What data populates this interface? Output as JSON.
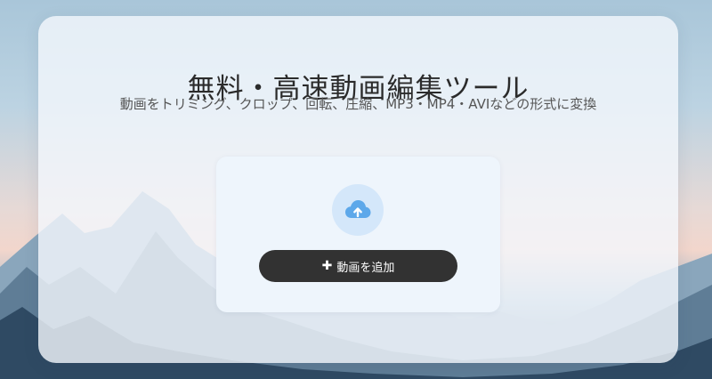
{
  "hero": {
    "title": "無料・高速動画編集ツール",
    "subtitle": "動画をトリミング、クロップ、回転、圧縮、MP3・MP4・AVIなどの形式に変換"
  },
  "uploader": {
    "icon": "cloud-upload-icon",
    "button_icon": "plus-icon",
    "button_icon_glyph": "✚",
    "button_label": "動画を追加"
  },
  "colors": {
    "button_bg": "#323232",
    "icon_circle": "#d4e7fa",
    "icon_cloud": "#5da8ea"
  }
}
